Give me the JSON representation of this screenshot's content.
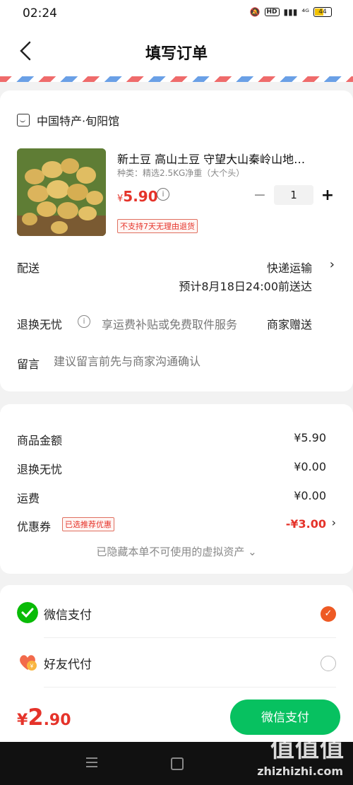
{
  "status": {
    "time": "02:24",
    "hd": "HD",
    "network": "⁴ᴳ",
    "battery": "44"
  },
  "header": {
    "title": "填写订单"
  },
  "shop": {
    "name": "中国特产·旬阳馆"
  },
  "product": {
    "title": "新土豆 高山土豆 守望大山秦岭山地…",
    "spec": "种类：精选2.5KG净重（大个头）",
    "price_symbol": "¥",
    "price": "5.90",
    "quantity": "1",
    "minus": "−",
    "plus": "+",
    "return_note": "不支持7天无理由退货"
  },
  "delivery": {
    "label": "配送",
    "method": "快递运输",
    "eta": "预计8月18日24:00前送达"
  },
  "worry_free": {
    "label": "退换无忧",
    "hint": "享运费补贴或免费取件服务",
    "gift": "商家赠送"
  },
  "note": {
    "label": "留言",
    "placeholder": "建议留言前先与商家沟通确认"
  },
  "summary": {
    "goods_label": "商品金额",
    "goods_value": "¥5.90",
    "worry_label": "退换无忧",
    "worry_value": "¥0.00",
    "shipping_label": "运费",
    "shipping_value": "¥0.00",
    "coupon_label": "优惠券",
    "coupon_tag": "已选推荐优惠",
    "coupon_value": "-¥3.00",
    "hidden_assets": "已隐藏本单不可使用的虚拟资产 ⌄"
  },
  "payment": {
    "options": [
      {
        "label": "微信支付",
        "icon": "wechat-pay-icon",
        "selected": true
      },
      {
        "label": "好友代付",
        "icon": "friend-pay-icon",
        "selected": false
      }
    ]
  },
  "bottom": {
    "currency": "¥",
    "total_int": "2",
    "total_dec": ".90",
    "pay_button": "微信支付"
  },
  "watermark": {
    "main": "值值值",
    "sub": "zhizhizhi.com"
  },
  "colors": {
    "accent": "#e5332a",
    "wechat_green": "#07c160",
    "radio_orange": "#ee5a24"
  }
}
